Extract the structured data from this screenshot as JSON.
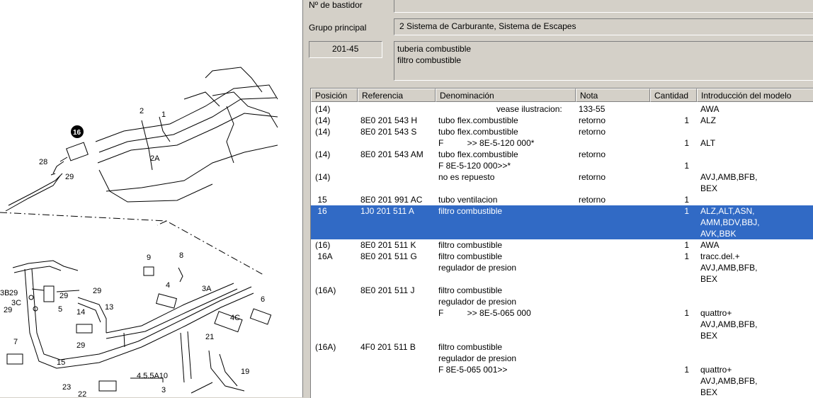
{
  "header": {
    "chassis_label": "Nº de bastidor",
    "chassis_value": "",
    "group_label": "Grupo principal",
    "group_value": "2   Sistema de Carburante, Sistema de Escapes",
    "subgroup_code": "201-45",
    "subgroup_desc": [
      "tuberia combustible",
      "filtro combustible"
    ]
  },
  "table": {
    "columns": [
      "Posición",
      "Referencia",
      "Denominación",
      "Nota",
      "Cantidad",
      "Introducción del modelo"
    ],
    "rows": [
      {
        "pos": "(14)",
        "ref": "",
        "den": [
          "vease ilustracion:"
        ],
        "nota": "133-55",
        "cant": "",
        "intro": [
          "AWA"
        ],
        "selected": false
      },
      {
        "pos": "(14)",
        "ref": "8E0 201 543 H",
        "den": [
          "tubo flex.combustible"
        ],
        "nota": "retorno",
        "cant": "1",
        "intro": [
          "ALZ"
        ],
        "selected": false
      },
      {
        "pos": "(14)",
        "ref": "8E0 201 543 S",
        "den": [
          "tubo flex.combustible",
          "F          >> 8E-5-120 000*"
        ],
        "nota": "retorno",
        "cant": "1",
        "intro": [
          "",
          "ALT"
        ],
        "selected": false
      },
      {
        "pos": "(14)",
        "ref": "8E0 201 543 AM",
        "den": [
          "tubo flex.combustible",
          "F 8E-5-120 000>>*"
        ],
        "nota": "retorno",
        "cant": "1",
        "intro": [
          "",
          ""
        ],
        "selected": false
      },
      {
        "pos": "(14)",
        "ref": "",
        "den": [
          "no es repuesto"
        ],
        "nota": "retorno",
        "cant": "",
        "intro": [
          "AVJ,AMB,BFB,",
          "BEX"
        ],
        "selected": false
      },
      {
        "pos": " 15",
        "ref": "8E0 201 991 AC",
        "den": [
          "tubo ventilacion"
        ],
        "nota": "retorno",
        "cant": "1",
        "intro": [
          ""
        ],
        "selected": false
      },
      {
        "pos": " 16",
        "ref": "1J0 201 511 A",
        "den": [
          "filtro combustible"
        ],
        "nota": "",
        "cant": "1",
        "intro": [
          "ALZ,ALT,ASN,",
          "AMM,BDV,BBJ,",
          "AVK,BBK"
        ],
        "selected": true
      },
      {
        "pos": "(16)",
        "ref": "8E0 201 511 K",
        "den": [
          "filtro combustible"
        ],
        "nota": "",
        "cant": "1",
        "intro": [
          "AWA"
        ],
        "selected": false
      },
      {
        "pos": " 16A",
        "ref": "8E0 201 511 G",
        "den": [
          "filtro combustible",
          "regulador de presion"
        ],
        "nota": "",
        "cant": "1",
        "intro": [
          "tracc.del.+",
          "AVJ,AMB,BFB,",
          "BEX"
        ],
        "selected": false
      },
      {
        "pos": "(16A)",
        "ref": "8E0 201 511 J",
        "den": [
          "filtro combustible",
          "regulador de presion",
          "F          >> 8E-5-065 000"
        ],
        "nota": "",
        "cant": "1",
        "intro": [
          "",
          "",
          "quattro+",
          "AVJ,AMB,BFB,",
          "BEX"
        ],
        "selected": false
      },
      {
        "pos": "(16A)",
        "ref": "4F0 201 511 B",
        "den": [
          "filtro combustible",
          "regulador de presion",
          "F 8E-5-065 001>>"
        ],
        "nota": "",
        "cant": "1",
        "intro": [
          "",
          "",
          "quattro+",
          "AVJ,AMB,BFB,",
          "BEX"
        ],
        "selected": false
      }
    ]
  },
  "diagram": {
    "callouts": [
      "1",
      "2",
      "2A",
      "3",
      "3A",
      "3B",
      "3C",
      "4",
      "4C",
      "4.5.5A10",
      "5",
      "6",
      "7",
      "8",
      "9",
      "13",
      "14",
      "15",
      "16",
      "19",
      "21",
      "22",
      "23",
      "28",
      "29"
    ]
  },
  "colors": {
    "selection": "#316ac5",
    "chrome": "#d4d0c8"
  }
}
